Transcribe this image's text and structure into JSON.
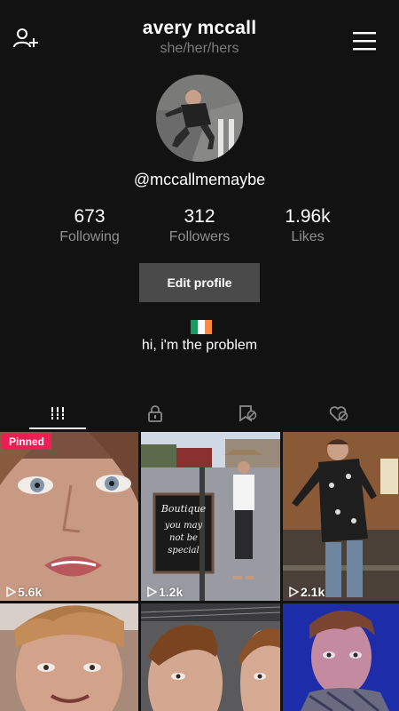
{
  "profile": {
    "name": "avery mccall",
    "pronouns": "she/her/hers",
    "handle": "@mccallmemaybe",
    "bio": "hi, i'm the problem",
    "flag_colors": [
      "#169b62",
      "#ffffff",
      "#ff883e"
    ]
  },
  "stats": {
    "following": {
      "value": "673",
      "label": "Following"
    },
    "followers": {
      "value": "312",
      "label": "Followers"
    },
    "likes": {
      "value": "1.96k",
      "label": "Likes"
    }
  },
  "actions": {
    "edit_profile": "Edit profile"
  },
  "tabs": [
    {
      "icon": "grid-icon",
      "active": true
    },
    {
      "icon": "lock-icon",
      "active": false
    },
    {
      "icon": "bookmark-icon",
      "active": false
    },
    {
      "icon": "liked-icon",
      "active": false
    }
  ],
  "videos": [
    {
      "views": "5.6k",
      "pinned_label": "Pinned"
    },
    {
      "views": "1.2k",
      "sign_text": [
        "Boutique",
        "you may",
        "not be",
        "special"
      ]
    },
    {
      "views": "2.1k"
    },
    {
      "views": ""
    },
    {
      "views": ""
    },
    {
      "views": ""
    }
  ],
  "colors": {
    "background": "#121212",
    "pinned": "#ee1d52",
    "button": "#4a4a4a"
  }
}
